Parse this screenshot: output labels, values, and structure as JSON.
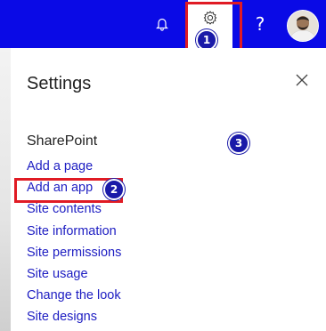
{
  "header": {
    "icons": [
      "bell-icon",
      "gear-icon",
      "help-icon",
      "avatar"
    ],
    "help_label": "?",
    "brand_color": "#0a0ae6"
  },
  "panel": {
    "title": "Settings",
    "close_icon": "close-icon",
    "section_title": "SharePoint",
    "links": [
      "Add a page",
      "Add an app",
      "Site contents",
      "Site information",
      "Site permissions",
      "Site usage",
      "Change the look",
      "Site designs"
    ],
    "link_color": "#1d1dc2"
  },
  "annotations": {
    "badges": [
      "1",
      "2",
      "3"
    ],
    "highlight_color": "#e01b24"
  }
}
